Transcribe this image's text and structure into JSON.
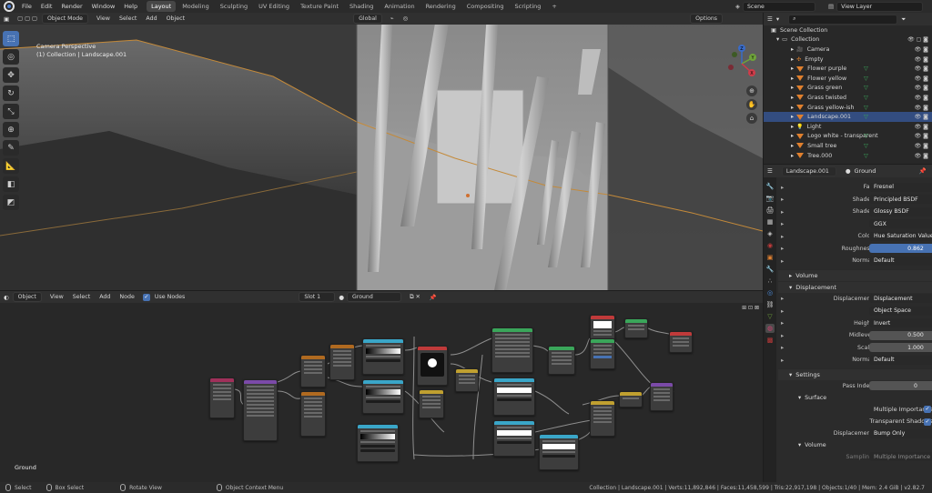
{
  "menu": {
    "items": [
      "File",
      "Edit",
      "Render",
      "Window",
      "Help"
    ]
  },
  "workspaces": [
    "Layout",
    "Modeling",
    "Sculpting",
    "UV Editing",
    "Texture Paint",
    "Shading",
    "Animation",
    "Rendering",
    "Compositing",
    "Scripting"
  ],
  "add_workspace": "+",
  "top_right": {
    "scene": "Scene",
    "view_layer": "View Layer"
  },
  "viewport": {
    "mode": "Object Mode",
    "menus": [
      "View",
      "Select",
      "Add",
      "Object"
    ],
    "orientation": "Global",
    "options": "Options",
    "perspective_label": "Camera Perspective",
    "collection_label": "(1) Collection | Landscape.001"
  },
  "gizmo": {
    "z": "Z",
    "y": "Y",
    "x": "X"
  },
  "node_editor": {
    "object_type": "Object",
    "menus": [
      "View",
      "Select",
      "Add",
      "Node"
    ],
    "use_nodes_label": "Use Nodes",
    "slot": "Slot 1",
    "material": "Ground",
    "footer_label": "Ground"
  },
  "outliner": {
    "search_placeholder": "",
    "scene_collection": "Scene Collection",
    "collection": "Collection",
    "items": [
      {
        "name": "Camera",
        "type": "camera"
      },
      {
        "name": "Empty",
        "type": "empty"
      },
      {
        "name": "Flower purple",
        "type": "mesh"
      },
      {
        "name": "Flower yellow",
        "type": "mesh"
      },
      {
        "name": "Grass green",
        "type": "mesh"
      },
      {
        "name": "Grass twisted",
        "type": "mesh"
      },
      {
        "name": "Grass yellow-ish",
        "type": "mesh"
      },
      {
        "name": "Landscape.001",
        "type": "mesh",
        "selected": true
      },
      {
        "name": "Light",
        "type": "light"
      },
      {
        "name": "Logo white - transparent",
        "type": "mesh"
      },
      {
        "name": "Small tree",
        "type": "mesh"
      },
      {
        "name": "Tree.000",
        "type": "mesh"
      }
    ]
  },
  "properties": {
    "object": "Landscape.001",
    "material": "Ground",
    "rows": [
      {
        "label": "Fac",
        "value": "Fresnel",
        "style": "dark"
      },
      {
        "label": "Shader",
        "value": "Principled BSDF",
        "style": "dark"
      },
      {
        "label": "Shader",
        "value": "Glossy BSDF",
        "style": "dark"
      },
      {
        "label": "",
        "value": "GGX",
        "style": "dark"
      },
      {
        "label": "Color",
        "value": "Hue Saturation Value",
        "style": "dark"
      },
      {
        "label": "Roughness",
        "value": "0.862",
        "style": "blue"
      },
      {
        "label": "Normal",
        "value": "Default",
        "style": "dark"
      }
    ],
    "sections": {
      "volume": "Volume",
      "displacement": "Displacement",
      "settings": "Settings",
      "surface": "Surface",
      "volume2": "Volume"
    },
    "displacement_rows": [
      {
        "label": "Displacement",
        "value": "Displacement",
        "style": "dark"
      },
      {
        "label": "",
        "value": "Object Space",
        "style": "dark"
      },
      {
        "label": "Height",
        "value": "Invert",
        "style": "dark"
      },
      {
        "label": "Midlevel",
        "value": "0.500",
        "style": "num"
      },
      {
        "label": "Scale",
        "value": "1.000",
        "style": "num"
      },
      {
        "label": "Normal",
        "value": "Default",
        "style": "dark"
      }
    ],
    "pass_index_label": "Pass Index",
    "pass_index": "0",
    "multiple_importance": "Multiple Importance",
    "transparent_shadows": "Transparent Shadows",
    "displacement_label": "Displacement",
    "displacement_method": "Bump Only",
    "sampling_label": "Sampling",
    "sampling_value": "Multiple Importance"
  },
  "statusbar": {
    "select": "Select",
    "box_select": "Box Select",
    "rotate_view": "Rotate View",
    "context_menu": "Object Context Menu",
    "stats": "Collection | Landscape.001 | Verts:11,892,846 | Faces:11,458,599 | Tris:22,917,198 | Objects:1/40 | Mem: 2.4 GiB | v2.82.7"
  },
  "colors": {
    "accent": "#4772b3",
    "selected_row": "#334d80",
    "mesh_icon": "#e0802e"
  }
}
